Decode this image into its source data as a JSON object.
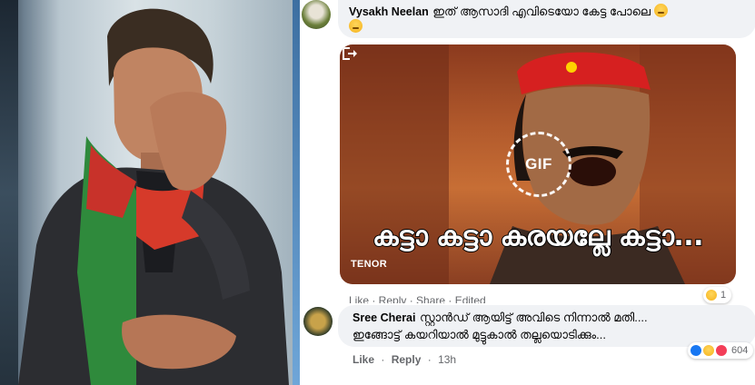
{
  "comments": [
    {
      "author": "Vysakh Neelan",
      "text": "ഇത് ആസാദി എവിടെയോ കേട്ട പോലെ",
      "emoji": [
        "thinking-face",
        "rolling-eyes-face"
      ],
      "gif": {
        "badge": "GIF",
        "caption": "കട്ടാ കട്ടാ കരയല്ലേ കട്ടാ...",
        "source": "TENOR"
      },
      "reaction_count": "1",
      "truncated_meta": "Like · Reply · Share · Edited"
    },
    {
      "author": "Sree Cherai",
      "line1": "സ്റ്റാൻഡ് ആയിട്ട് അവിടെ നിന്നാൽ മതി....",
      "line2": "ഇങ്ങോട്ട് കയറിയാൽ മുട്ടുകാൽ തല്ലയൊടിക്കും...",
      "reaction_count": "604",
      "actions": {
        "like": "Like",
        "reply": "Reply",
        "time": "13h"
      }
    }
  ],
  "colors": {
    "bubble": "#f0f2f5",
    "meta": "#65676b",
    "like_blue": "#1877f2"
  }
}
